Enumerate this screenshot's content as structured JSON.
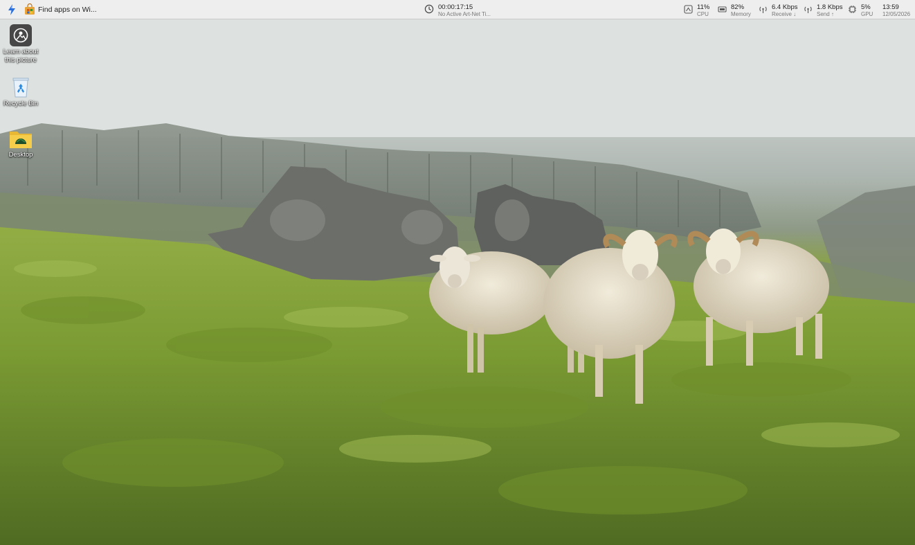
{
  "taskbar": {
    "apps": [
      {
        "name": "power-automate",
        "icon": "bolt-icon",
        "color": "#2a6fdb"
      },
      {
        "name": "store",
        "icon": "store-bag-icon",
        "color": "#e8a33a"
      }
    ],
    "active_window_title": "Find apps on Wi...",
    "timer": {
      "value": "00:00:17:15",
      "status": "No Active Art-Net Ti..."
    },
    "stats": {
      "cpu": {
        "value": "11%",
        "label": "CPU"
      },
      "memory": {
        "value": "82%",
        "label": "Memory"
      },
      "receive": {
        "value": "6.4 Kbps",
        "label": "Receive ↓"
      },
      "send": {
        "value": "1.8 Kbps",
        "label": "Send ↑"
      },
      "gpu": {
        "value": "5%",
        "label": "GPU"
      }
    },
    "clock": {
      "time": "13:59",
      "date": "12/05/2026"
    }
  },
  "desktop": {
    "icons": [
      {
        "label": "Learn about this picture",
        "icon": "camera-icon"
      },
      {
        "label": "Recycle Bin",
        "icon": "recycle-bin-icon"
      },
      {
        "label": "Desktop",
        "icon": "folder-icon"
      }
    ]
  }
}
